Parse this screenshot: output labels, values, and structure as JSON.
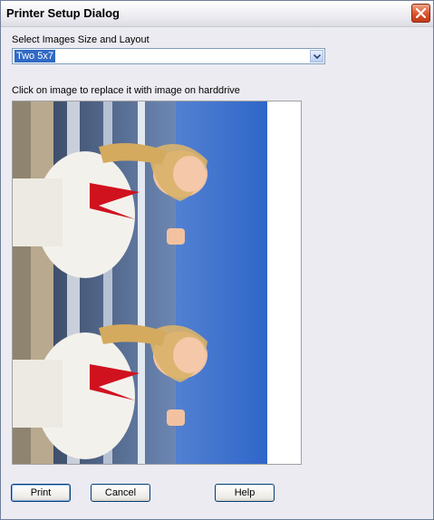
{
  "window": {
    "title": "Printer Setup Dialog"
  },
  "layout_section": {
    "label": "Select Images Size and Layout",
    "selected_value": "Two 5x7"
  },
  "preview_section": {
    "instruction": "Click on image to replace it with image on harddrive",
    "photos": [
      {
        "name": "photo-slot-1"
      },
      {
        "name": "photo-slot-2"
      }
    ]
  },
  "buttons": {
    "print_label": "Print",
    "cancel_label": "Cancel",
    "help_label": "Help"
  },
  "colors": {
    "selection": "#316ac5",
    "close_button": "#d9532d",
    "button_border": "#003c74"
  }
}
